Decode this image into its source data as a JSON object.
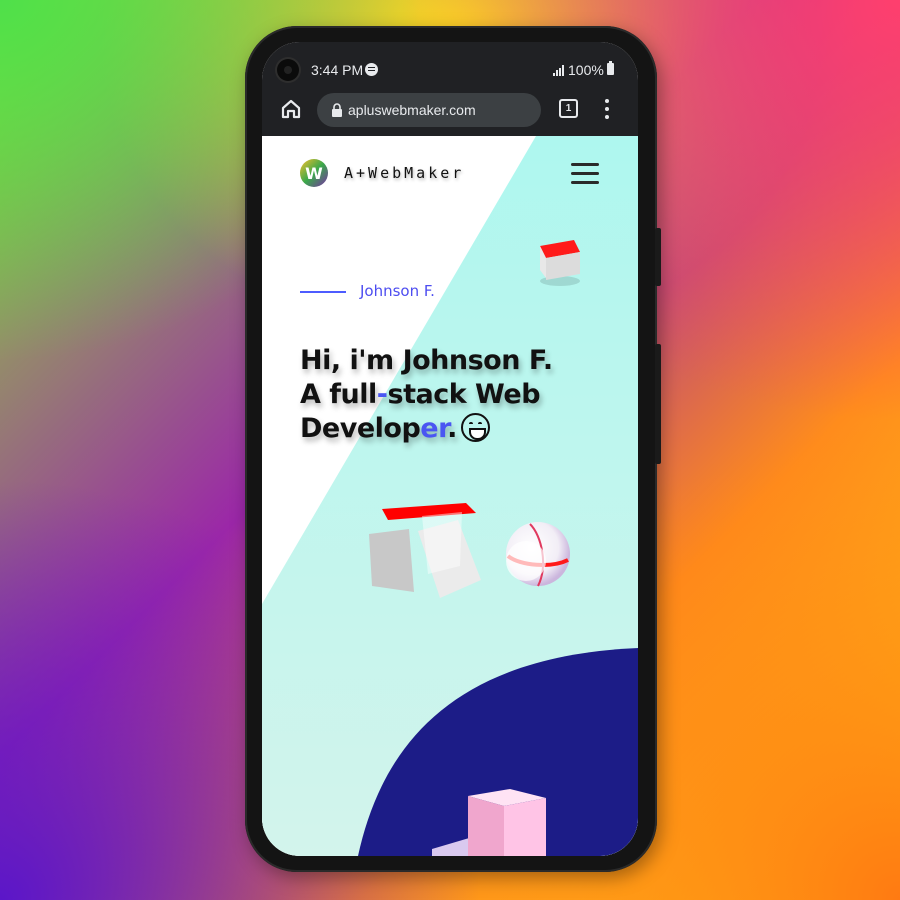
{
  "status_bar": {
    "time": "3:44 PM",
    "battery": "100%",
    "icons": [
      "camera-icon",
      "spotify-icon",
      "signal-icon",
      "battery-icon"
    ]
  },
  "browser": {
    "url": "apluswebmaker.com",
    "tab_count": "1",
    "icons": [
      "home-icon",
      "lock-icon",
      "tabs-icon",
      "more-vert-icon"
    ]
  },
  "site": {
    "brand": "A+WebMaker",
    "logo_letter": "W",
    "name_tag": "Johnson F.",
    "headline": {
      "line1": "Hi, i'm Johnson F.",
      "line2_a": "A full",
      "line2_dash": "-",
      "line2_b": "stack Web",
      "line3_a": "Develop",
      "line3_accent": "er",
      "line3_b": "."
    }
  },
  "colors": {
    "accent": "#4a56f2",
    "mint": "#b2f5ec",
    "navy": "#1c1c87",
    "cube_red": "#ff0000",
    "cube_pink": "#f6b7d8"
  }
}
